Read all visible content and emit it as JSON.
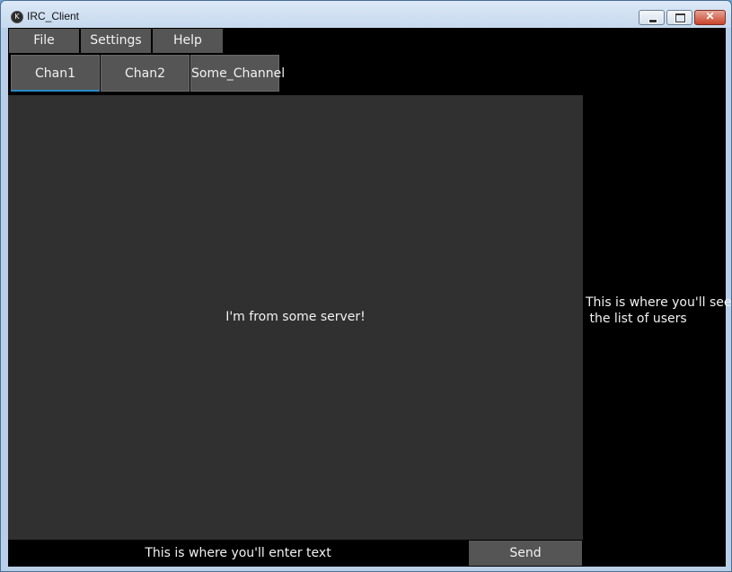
{
  "window": {
    "title": "IRC_Client",
    "icon": "kivy-app-icon",
    "controls": {
      "minimize": "minimize-icon",
      "maximize": "maximize-icon",
      "close": "✕"
    }
  },
  "menu": {
    "items": [
      {
        "label": "File"
      },
      {
        "label": "Settings"
      },
      {
        "label": "Help"
      }
    ]
  },
  "tabs": {
    "items": [
      {
        "label": "Chan1",
        "active": true
      },
      {
        "label": "Chan2",
        "active": false
      },
      {
        "label": "Some_Channel",
        "active": false
      }
    ]
  },
  "chat": {
    "message": "I'm from some server!"
  },
  "users": {
    "placeholder": "This is where you'll see\n the list of users"
  },
  "input": {
    "placeholder": "This is where you'll enter text",
    "value": ""
  },
  "send": {
    "label": "Send"
  },
  "colors": {
    "accent": "#2a8ac8",
    "button": "#555555",
    "chat_bg": "#303030",
    "client_bg": "#000000"
  }
}
